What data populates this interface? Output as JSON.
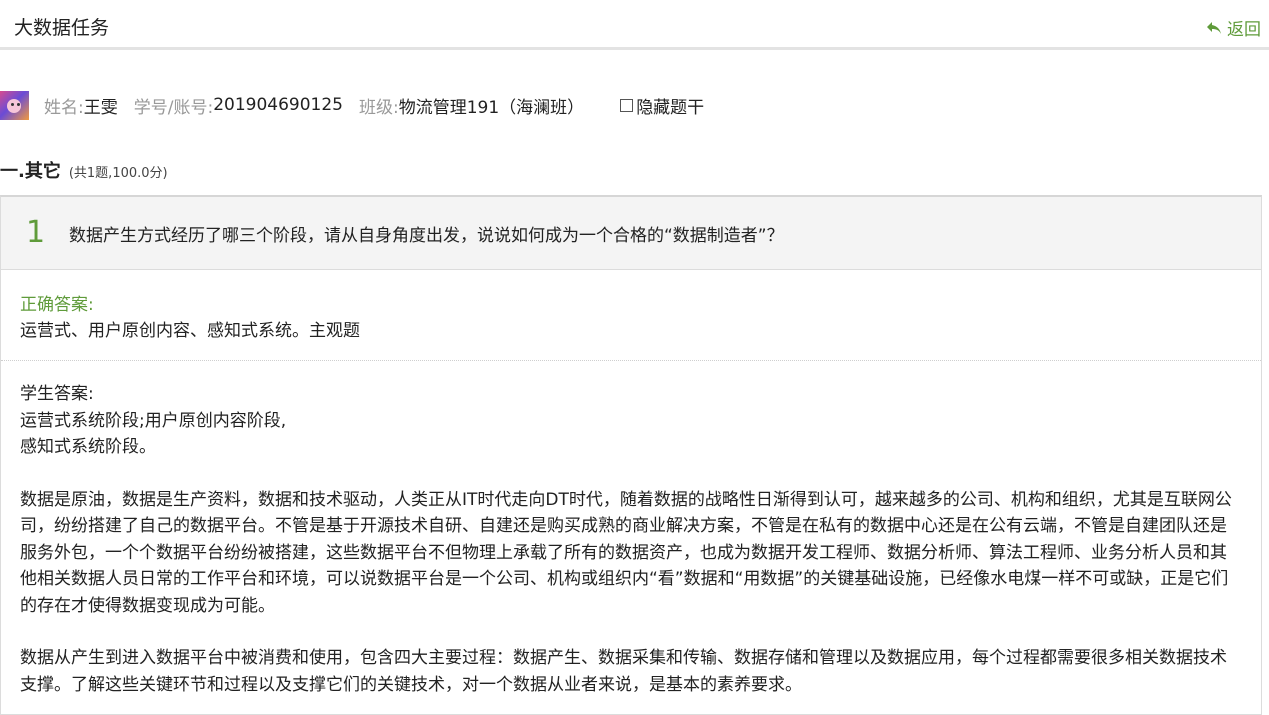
{
  "header": {
    "title": "大数据任务",
    "back_label": "返回"
  },
  "student": {
    "name_label": "姓名:",
    "name": "王雯",
    "id_label": "学号/账号:",
    "id": "201904690125",
    "class_label": "班级:",
    "class": "物流管理191（海澜班）",
    "hide_stem_label": "隐藏题干"
  },
  "section": {
    "title": "一.其它",
    "meta": "(共1题,100.0分)"
  },
  "question": {
    "number": "1",
    "text": "数据产生方式经历了哪三个阶段，请从自身角度出发，说说如何成为一个合格的“数据制造者”？",
    "correct_label": "正确答案:",
    "correct_answer": "运营式、用户原创内容、感知式系统。主观题",
    "student_label": "学生答案:",
    "student_lines": [
      "运营式系统阶段;用户原创内容阶段,",
      "感知式系统阶段。"
    ],
    "student_para1": "数据是原油，数据是生产资料，数据和技术驱动，人类正从IT时代走向DT时代，随着数据的战略性日渐得到认可，越来越多的公司、机构和组织，尤其是互联网公司，纷纷搭建了自己的数据平台。不管是基于开源技术自研、自建还是购买成熟的商业解决方案，不管是在私有的数据中心还是在公有云端，不管是自建团队还是服务外包，一个个数据平台纷纷被搭建，这些数据平台不但物理上承载了所有的数据资产，也成为数据开发工程师、数据分析师、算法工程师、业务分析人员和其他相关数据人员日常的工作平台和环境，可以说数据平台是一个公司、机构或组织内“看”数据和“用数据”的关键基础设施，已经像水电煤一样不可或缺，正是它们的存在才使得数据变现成为可能。",
    "student_para2": "数据从产生到进入数据平台中被消费和使用，包含四大主要过程：数据产生、数据采集和传输、数据存储和管理以及数据应用，每个过程都需要很多相关数据技术支撑。了解这些关键环节和过程以及支撑它们的关键技术，对一个数据从业者来说，是基本的素养要求。"
  },
  "colors": {
    "accent": "#5f9b3a",
    "muted": "#999999",
    "card_header": "#f4f4f4"
  }
}
